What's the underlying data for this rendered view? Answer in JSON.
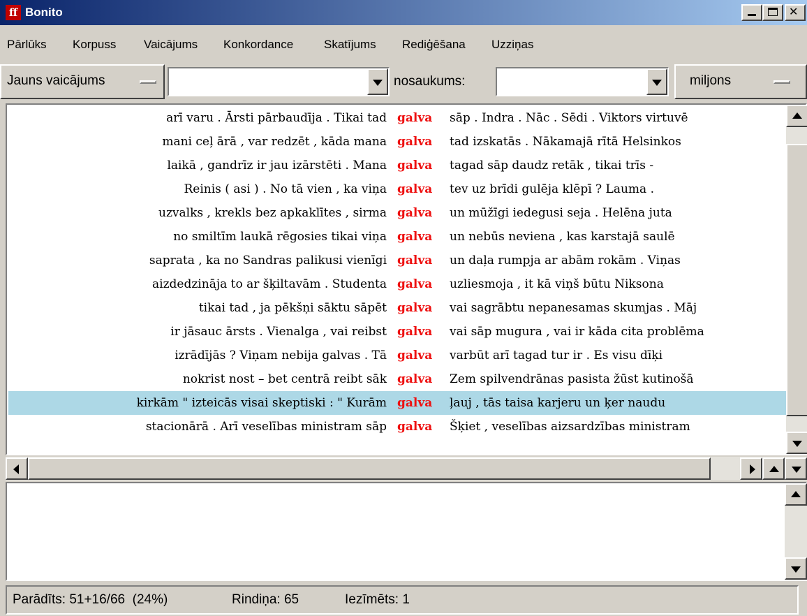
{
  "window": {
    "title": "Bonito",
    "app_icon": "ff"
  },
  "menu": [
    "Pārlūks",
    "Korpuss",
    "Vaicājums",
    "Konkordance",
    "Skatījums",
    "Rediģēšana",
    "Uzziņas"
  ],
  "toolbar": {
    "query_type_button": "Jauns vaicājums",
    "query_value": "",
    "name_label": "nosaukums:",
    "name_value": "",
    "corpus_button": "miljons"
  },
  "concordance": {
    "keyword_color": "#ee1111",
    "selected_color": "#add8e6",
    "rows": [
      {
        "left": "arī varu . Ārsti pārbaudīja . Tikai tad",
        "kw": "galva",
        "right": "sāp . Indra . Nāc . Sēdi . Viktors virtuvē"
      },
      {
        "left": "mani ceļ ārā , var redzēt , kāda mana",
        "kw": "galva",
        "right": "tad izskatās . Nākamajā rītā Helsinkos"
      },
      {
        "left": "laikā , gandrīz ir jau izārstēti . Mana",
        "kw": "galva",
        "right": "tagad sāp daudz retāk , tikai trīs -"
      },
      {
        "left": "Reinis ( asi ) . No tā vien , ka viņa",
        "kw": "galva",
        "right": "tev uz brīdi gulēja klēpī ? Lauma ."
      },
      {
        "left": "uzvalks , krekls bez apkaklītes , sirma",
        "kw": "galva",
        "right": "un mūžīgi iedegusi seja . Helēna juta"
      },
      {
        "left": "no smiltīm laukā rēgosies tikai viņa",
        "kw": "galva",
        "right": "un nebūs neviena , kas karstajā saulē"
      },
      {
        "left": "saprata , ka no Sandras palikusi vienīgi",
        "kw": "galva",
        "right": "un daļa rumpja ar abām rokām . Viņas"
      },
      {
        "left": "aizdedzināja to ar šķiltavām . Studenta",
        "kw": "galva",
        "right": "uzliesmoja , it kā viņš būtu Niksona"
      },
      {
        "left": "tikai tad , ja pēkšņi sāktu sāpēt",
        "kw": "galva",
        "right": "vai sagrābtu nepanesamas skumjas . Māj"
      },
      {
        "left": "ir jāsauc ārsts . Vienalga , vai reibst",
        "kw": "galva",
        "right": "vai sāp mugura , vai ir kāda cita problēma"
      },
      {
        "left": "izrādījās ? Viņam nebija galvas . Tā",
        "kw": "galva",
        "right": "varbūt arī tagad tur ir . Es visu dīķi"
      },
      {
        "left": "nokrist nost – bet centrā reibt sāk",
        "kw": "galva",
        "right": "Zem spilvendrānas pasista žūst kutinošā"
      },
      {
        "left": "kirkām \" izteicās visai skeptiski : \" Kurām",
        "kw": "galva",
        "right": "ļauj , tās taisa karjeru un ķer naudu",
        "selected": true
      },
      {
        "left": "stacionārā . Arī veselības ministram sāp",
        "kw": "galva",
        "right": "Šķiet , veselības aizsardzības ministram"
      }
    ]
  },
  "status": {
    "shown": "Parādīts: 51+16/66  (24%)",
    "line": "Rindiņa: 65",
    "marked": "Iezīmēts: 1"
  },
  "icons": {
    "minimize": "minimize-icon",
    "maximize": "maximize-icon",
    "close": "close-icon",
    "dropdown": "chevron-down-icon"
  }
}
